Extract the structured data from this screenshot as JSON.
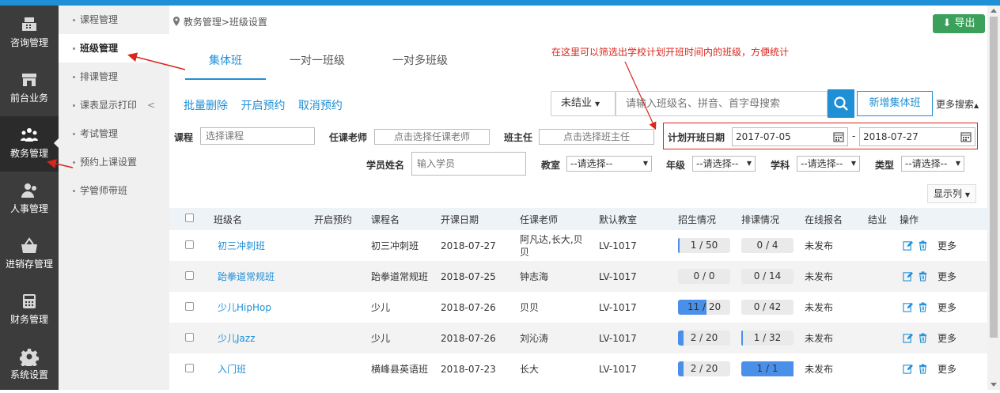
{
  "nav": {
    "items": [
      {
        "label": "咨询管理",
        "icon": "register-icon"
      },
      {
        "label": "前台业务",
        "icon": "store-icon"
      },
      {
        "label": "教务管理",
        "icon": "people-icon",
        "active": true
      },
      {
        "label": "人事管理",
        "icon": "person-icon"
      },
      {
        "label": "进销存管理",
        "icon": "basket-icon"
      },
      {
        "label": "财务管理",
        "icon": "calculator-icon"
      },
      {
        "label": "系统设置",
        "icon": "gear-icon"
      }
    ]
  },
  "submenu": {
    "items": [
      {
        "label": "课程管理"
      },
      {
        "label": "班级管理",
        "active": true
      },
      {
        "label": "排课管理"
      },
      {
        "label": "课表显示打印",
        "chevron": "<"
      },
      {
        "label": "考试管理"
      },
      {
        "label": "预约上课设置"
      },
      {
        "label": "学管师带班"
      }
    ]
  },
  "breadcrumb": "教务管理>班级设置",
  "export_label": "导出",
  "tabs": [
    "集体班",
    "一对一班级",
    "一对多班级"
  ],
  "note": "在这里可以筛选出学校计划开班时间内的班级，方便统计",
  "actions": [
    "批量删除",
    "开启预约",
    "取消预约"
  ],
  "status_select": "未结业",
  "search_placeholder": "请输入班级名、拼音、首字母搜索",
  "add_label": "新增集体班",
  "more_search": "更多搜索",
  "filters": {
    "course_label": "课程",
    "course_placeholder": "选择课程",
    "teacher_label": "任课老师",
    "teacher_placeholder": "点击选择任课老师",
    "head_label": "班主任",
    "head_placeholder": "点击选择班主任",
    "plan_date_label": "计划开班日期",
    "date_start": "2017-07-05",
    "date_sep": "-",
    "date_end": "2018-07-27",
    "student_label": "学员姓名",
    "student_placeholder": "输入学员",
    "room_label": "教室",
    "room_value": "--请选择--",
    "grade_label": "年级",
    "grade_value": "--请选择--",
    "subject_label": "学科",
    "subject_value": "--请选择--",
    "type_label": "类型",
    "type_value": "--请选择--"
  },
  "show_columns": "显示列",
  "table": {
    "headers": [
      "班级名",
      "开启预约",
      "课程名",
      "开课日期",
      "任课老师",
      "默认教室",
      "招生情况",
      "排课情况",
      "在线报名",
      "结业",
      "操作"
    ],
    "more_label": "更多",
    "rows": [
      {
        "name": "初三冲刺班",
        "booking": "",
        "course": "初三冲刺班",
        "date": "2018-07-27",
        "teacher": "阿凡达,长大,贝贝",
        "room": "LV-1017",
        "enroll": "1 / 50",
        "enroll_pct": 2,
        "sched": "0 / 4",
        "sched_pct": 0,
        "online": "未发布",
        "grad": ""
      },
      {
        "name": "跆拳道常规班",
        "booking": "",
        "course": "跆拳道常规班",
        "date": "2018-07-25",
        "teacher": "钟志海",
        "room": "LV-1017",
        "enroll": "0 / 0",
        "enroll_pct": 0,
        "sched": "0 / 14",
        "sched_pct": 0,
        "online": "未发布",
        "grad": ""
      },
      {
        "name": "少儿HipHop",
        "booking": "",
        "course": "少儿",
        "date": "2018-07-26",
        "teacher": "贝贝",
        "room": "LV-1017",
        "enroll": "11 / 20",
        "enroll_pct": 55,
        "sched": "0 / 42",
        "sched_pct": 0,
        "online": "未发布",
        "grad": ""
      },
      {
        "name": "少儿Jazz",
        "booking": "",
        "course": "少儿",
        "date": "2018-07-26",
        "teacher": "刘沁涛",
        "room": "LV-1017",
        "enroll": "2 / 20",
        "enroll_pct": 10,
        "sched": "1 / 32",
        "sched_pct": 3,
        "online": "未发布",
        "grad": ""
      },
      {
        "name": "入门班",
        "booking": "",
        "course": "横峰县英语班",
        "date": "2018-07-23",
        "teacher": "长大",
        "room": "LV-1017",
        "enroll": "2 / 20",
        "enroll_pct": 10,
        "sched": "1 / 1",
        "sched_pct": 100,
        "online": "未发布",
        "grad": ""
      }
    ]
  },
  "colors": {
    "accent": "#1f8fd6",
    "export": "#3aa05a",
    "annotation": "#d9261c",
    "bar": "#4a8fe8"
  }
}
